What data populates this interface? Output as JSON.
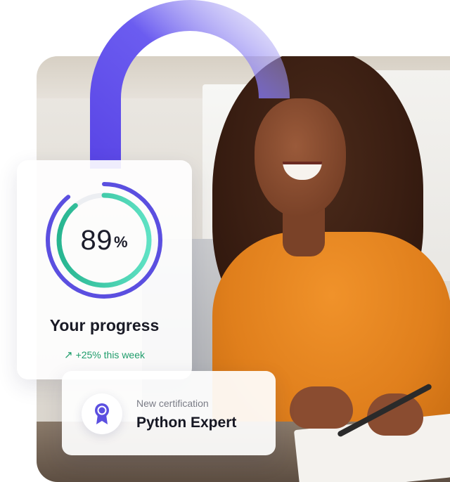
{
  "progress": {
    "value": 89,
    "percent_symbol": "%",
    "title": "Your progress",
    "delta_arrow": "↗",
    "delta_text": "+25% this week"
  },
  "certification": {
    "eyebrow": "New certification",
    "title": "Python Expert",
    "icon": "award-ribbon-icon"
  },
  "colors": {
    "accent_purple": "#5b4fe0",
    "accent_teal": "#3fd0b0",
    "positive_green": "#1f9d6b"
  }
}
